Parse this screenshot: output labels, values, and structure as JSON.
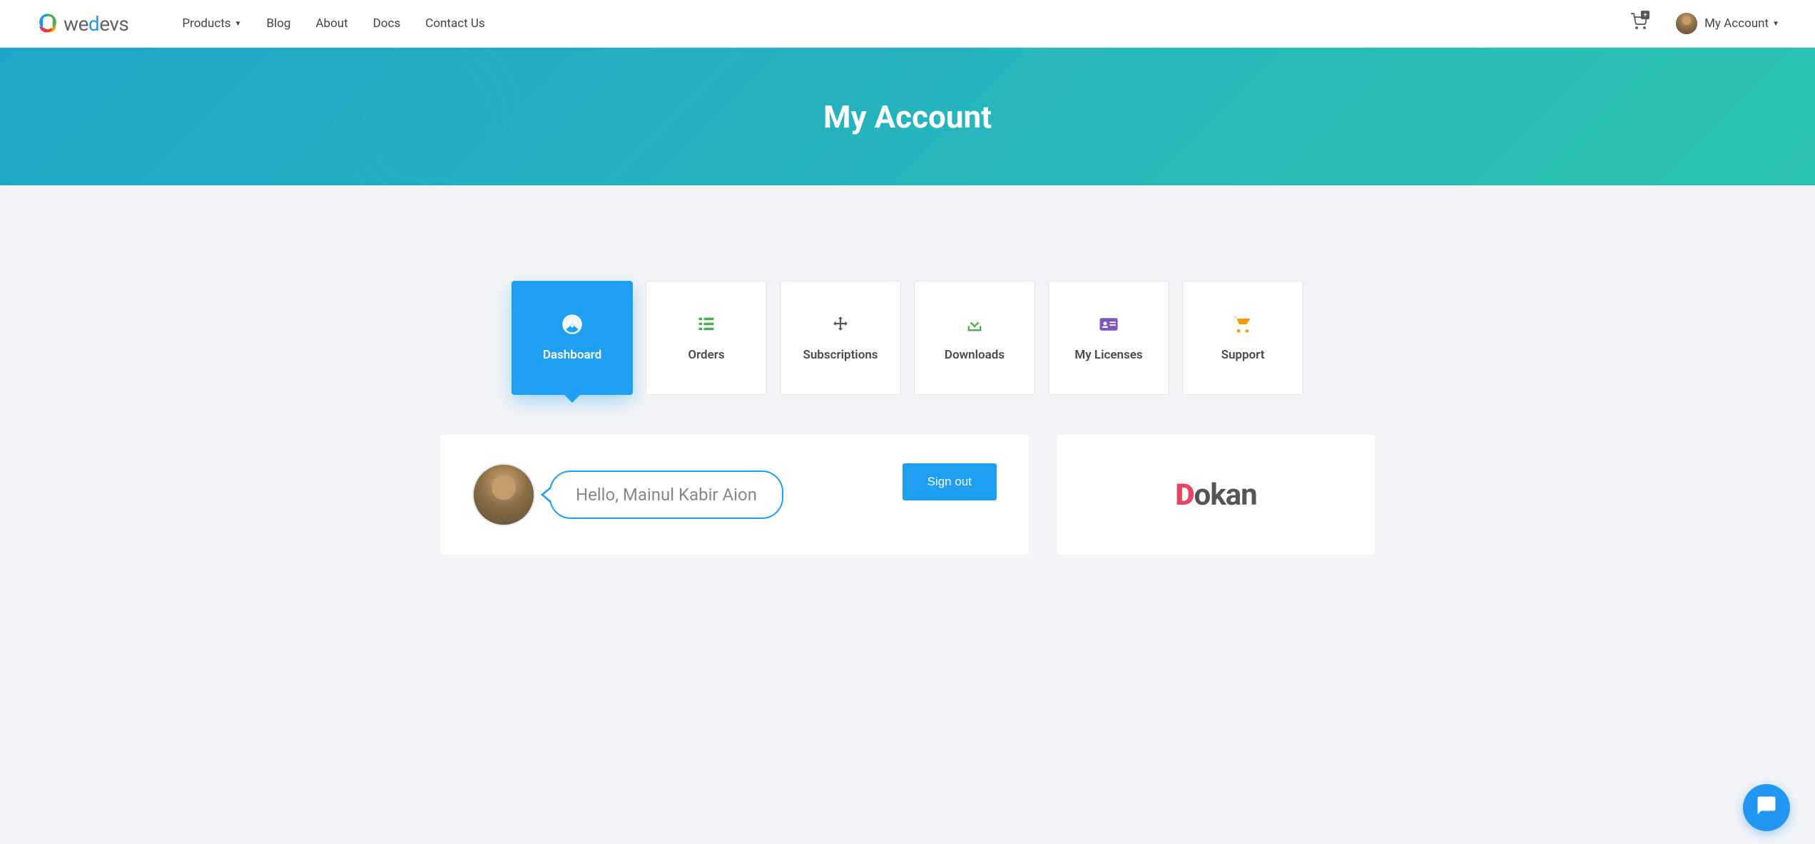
{
  "header": {
    "logo_text": "wedevs",
    "nav": [
      {
        "label": "Products",
        "has_dropdown": true
      },
      {
        "label": "Blog",
        "has_dropdown": false
      },
      {
        "label": "About",
        "has_dropdown": false
      },
      {
        "label": "Docs",
        "has_dropdown": false
      },
      {
        "label": "Contact Us",
        "has_dropdown": false
      }
    ],
    "account_label": "My Account"
  },
  "hero": {
    "title": "My Account"
  },
  "tabs": [
    {
      "label": "Dashboard",
      "icon": "dashboard",
      "active": true
    },
    {
      "label": "Orders",
      "icon": "orders",
      "active": false
    },
    {
      "label": "Subscriptions",
      "icon": "subscriptions",
      "active": false
    },
    {
      "label": "Downloads",
      "icon": "downloads",
      "active": false
    },
    {
      "label": "My Licenses",
      "icon": "licenses",
      "active": false
    },
    {
      "label": "Support",
      "icon": "support",
      "active": false
    }
  ],
  "greeting": {
    "text": "Hello, Mainul Kabir Aion",
    "signout_label": "Sign out"
  },
  "promo": {
    "brand": "Dokan"
  }
}
